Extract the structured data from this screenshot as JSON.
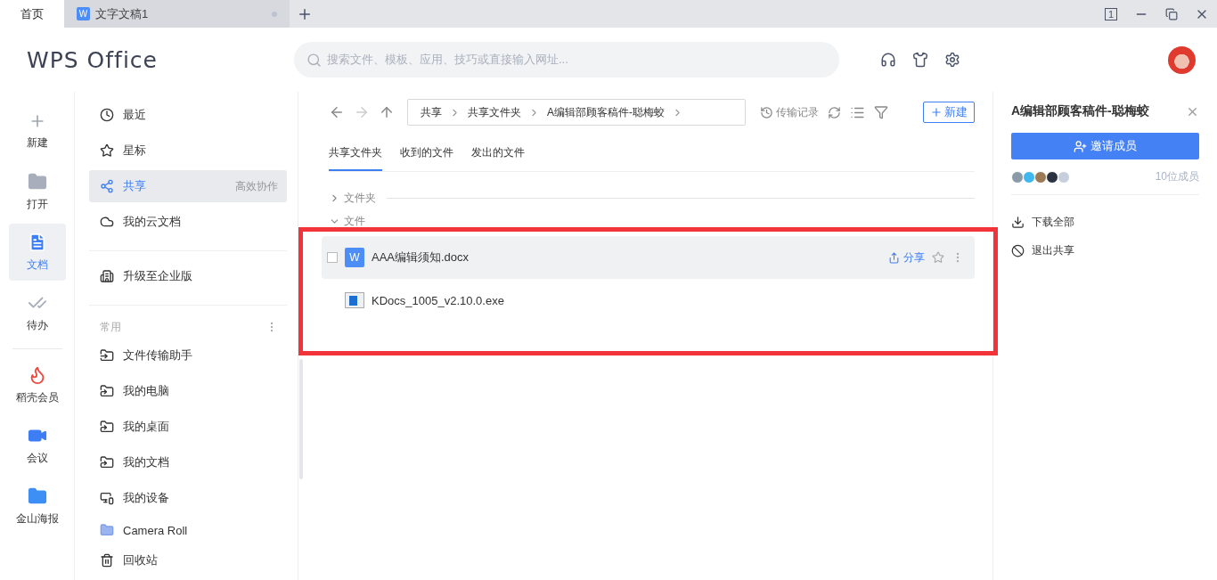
{
  "tabs": [
    {
      "label": "首页",
      "selected": true,
      "kind": "home"
    },
    {
      "label": "文字文稿1",
      "selected": false,
      "kind": "doc",
      "badge": "W"
    }
  ],
  "window_counter": "1",
  "logo": "WPS Office",
  "search": {
    "placeholder": "搜索文件、模板、应用、技巧或直接输入网址..."
  },
  "nav": [
    {
      "label": "新建",
      "selected": false,
      "kind": "new"
    },
    {
      "label": "打开",
      "selected": false,
      "kind": "open"
    },
    {
      "label": "文档",
      "selected": true,
      "kind": "docs"
    },
    {
      "label": "待办",
      "selected": false,
      "kind": "todo"
    },
    {
      "label": "稻壳会员",
      "selected": false,
      "kind": "vip"
    },
    {
      "label": "会议",
      "selected": false,
      "kind": "meeting"
    },
    {
      "label": "金山海报",
      "selected": false,
      "kind": "poster"
    }
  ],
  "sidebar": {
    "main": [
      {
        "label": "最近",
        "selected": false,
        "kind": "clock"
      },
      {
        "label": "星标",
        "selected": false,
        "kind": "star"
      },
      {
        "label": "共享",
        "selected": true,
        "kind": "share",
        "hint": "高效协作"
      },
      {
        "label": "我的云文档",
        "selected": false,
        "kind": "cloud"
      }
    ],
    "upgrade": {
      "label": "升级至企业版"
    },
    "common": {
      "title": "常用",
      "items": [
        {
          "label": "文件传输助手",
          "kind": "transfer"
        },
        {
          "label": "我的电脑",
          "kind": "link"
        },
        {
          "label": "我的桌面",
          "kind": "link"
        },
        {
          "label": "我的文档",
          "kind": "link"
        },
        {
          "label": "我的设备",
          "kind": "device"
        },
        {
          "label": "Camera Roll",
          "kind": "folder"
        }
      ]
    },
    "trash": "回收站"
  },
  "breadcrumb": [
    "共享",
    "共享文件夹",
    "A编辑部顾客稿件-聪梅蛟"
  ],
  "toolbar": {
    "history": "传输记录",
    "new_button": "新建"
  },
  "content_tabs": [
    {
      "label": "共享文件夹",
      "selected": true
    },
    {
      "label": "收到的文件",
      "selected": false
    },
    {
      "label": "发出的文件",
      "selected": false
    }
  ],
  "groups": [
    {
      "title": "文件夹",
      "expanded": false
    },
    {
      "title": "文件",
      "expanded": true
    }
  ],
  "files": [
    {
      "name": "AAA编辑须知.docx",
      "kind": "docx",
      "badge": "W",
      "hovered": true,
      "checked": false,
      "share": "分享"
    },
    {
      "name": "KDocs_1005_v2.10.0.exe",
      "kind": "exe",
      "hovered": false
    }
  ],
  "highlight_box": true,
  "panel": {
    "title": "A编辑部顾客稿件-聪梅蛟",
    "invite": "邀请成员",
    "avatars": [
      {
        "color": "#8a9aa8"
      },
      {
        "color": "#3fb8f0"
      },
      {
        "color": "#9b7a55"
      },
      {
        "color": "#2b3340"
      },
      {
        "color": "#c8cfdc"
      }
    ],
    "members": "10位成员",
    "actions": [
      {
        "label": "下载全部",
        "kind": "download"
      },
      {
        "label": "退出共享",
        "kind": "quit"
      }
    ]
  }
}
